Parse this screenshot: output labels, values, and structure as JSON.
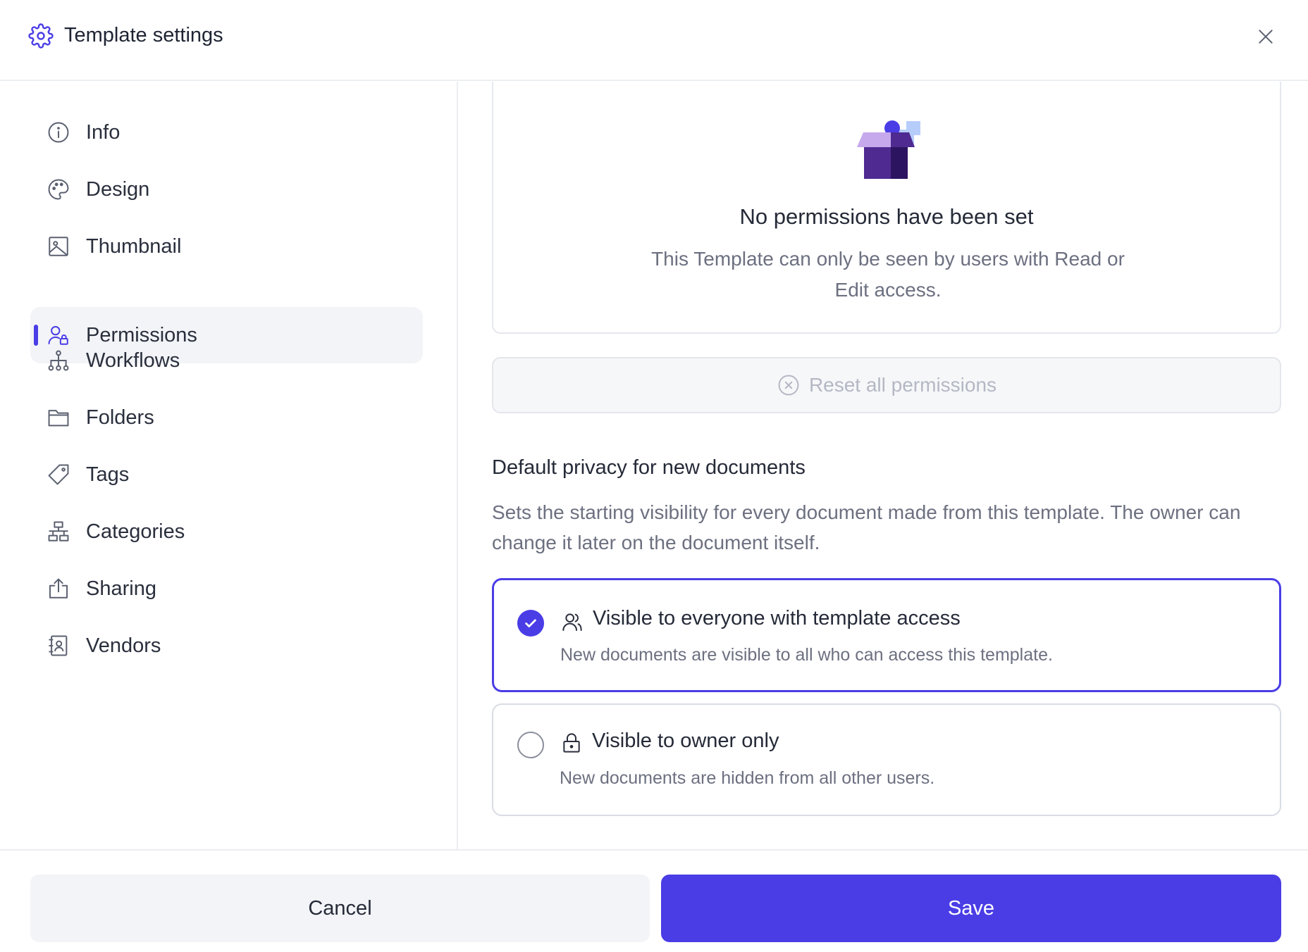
{
  "header": {
    "title": "Template settings"
  },
  "sidebar": {
    "items": [
      {
        "label": "Info",
        "icon": "info-icon"
      },
      {
        "label": "Design",
        "icon": "palette-icon"
      },
      {
        "label": "Thumbnail",
        "icon": "image-icon"
      },
      {
        "label": "Permissions",
        "icon": "user-lock-icon"
      },
      {
        "label": "Workflows",
        "icon": "hierarchy-icon"
      },
      {
        "label": "Folders",
        "icon": "folder-icon"
      },
      {
        "label": "Tags",
        "icon": "tag-icon"
      },
      {
        "label": "Categories",
        "icon": "categories-icon"
      },
      {
        "label": "Sharing",
        "icon": "share-icon"
      },
      {
        "label": "Vendors",
        "icon": "contact-book-icon"
      }
    ],
    "active": "Permissions"
  },
  "empty_state": {
    "title": "No permissions have been set",
    "description": "This Template can only be seen by users with Read or Edit access."
  },
  "reset_button": {
    "label": "Reset all permissions"
  },
  "privacy": {
    "title": "Default privacy for new documents",
    "description": "Sets the starting visibility for every document made from this template. The owner can change it later on the document itself.",
    "options": [
      {
        "label": "Visible to everyone with template access",
        "description": "New documents are visible to all who can access this template.",
        "selected": true
      },
      {
        "label": "Visible to owner only",
        "description": "New documents are hidden from all other users.",
        "selected": false
      }
    ]
  },
  "footer": {
    "cancel_label": "Cancel",
    "save_label": "Save"
  },
  "colors": {
    "accent": "#4a3de6",
    "border": "#e6e8ee",
    "muted_text": "#6c7080"
  }
}
